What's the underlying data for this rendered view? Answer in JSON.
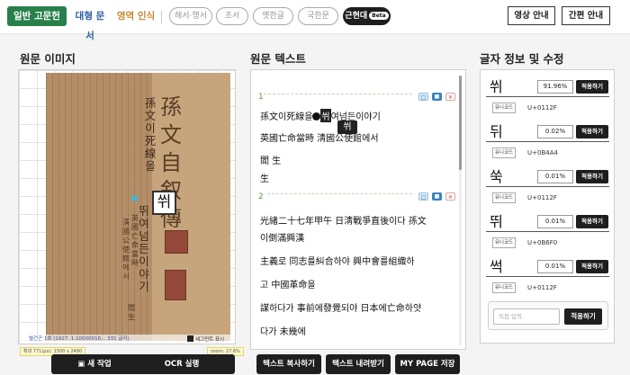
{
  "topbar": {
    "tab_general": "일반 고문헌",
    "tab_large": "대형 문서",
    "tab_area": "영역 인식",
    "pills": [
      "해서·행서",
      "초서",
      "옛한글",
      "국한문"
    ],
    "active_pill": "근현대",
    "active_badge": "Beta",
    "btn_video": "영상 안내",
    "btn_guide": "간편 안내"
  },
  "sections": {
    "image_title": "원문 이미지",
    "text_title": "원문 텍스트",
    "char_title": "글자 정보 및 수정"
  },
  "image_panel": {
    "doc_title": "孫文自叙傳",
    "col_main_1": "孫文이死線을",
    "col_main_2": "뛰여넘든이야기",
    "col_small_1": "英國亡命當時",
    "col_small_2": "淸國公使館에서",
    "col_small_3": "閻生",
    "highlight_char": "쒸",
    "caption": "별건곤 1호 (1927. 1.10000016... 331 글자)",
    "segment_toggle": "세그먼트 표시",
    "zoom_left": "확대 771(px): 1500 x 2480",
    "zoom_right": "zoom: 27.6%"
  },
  "image_buttons": {
    "new_task": "새 작업",
    "ocr_run": "OCR 실행"
  },
  "text_panel": {
    "segments": [
      {
        "num": "1",
        "line1_pre": "孫文이死線을",
        "line1_sel": "쒸",
        "line1_post": "여넘든이야기",
        "popup": "쒸",
        "lines": [
          "英國亡命當時 淸國公使館에서",
          "閻 生",
          "生"
        ]
      },
      {
        "num": "2",
        "lines": [
          "光緖二十七年甲午 日淸戰爭直後이다 孫文",
          "이倒滿興漢",
          "主義로 同志를糾合하야 興中會를組織하",
          "고 中國革命을",
          "謀하다가 事前에發覺되야 日本에亡命하얏",
          "다가 未幾에"
        ]
      }
    ],
    "btn_copy": "텍스트 복사하기",
    "btn_download": "텍스트 내려받기",
    "btn_mypage": "MY PAGE 저장"
  },
  "char_panel": {
    "candidates": [
      {
        "char": "쒸",
        "pct": "91.96%",
        "apply": "적용하기",
        "code_label": "유니코드",
        "code": "U+0112F"
      },
      {
        "char": "뒤",
        "pct": "0.02%",
        "apply": "적용하기",
        "code_label": "유니코드",
        "code": "U+0B4A4"
      },
      {
        "char": "쑥",
        "pct": "0.01%",
        "apply": "적용하기",
        "code_label": "유니코드",
        "code": "U+0112F"
      },
      {
        "char": "뛰",
        "pct": "0.01%",
        "apply": "적용하기",
        "code_label": "유니코드",
        "code": "U+0B6F0"
      },
      {
        "char": "썩",
        "pct": "0.01%",
        "apply": "적용하기",
        "code_label": "유니코드",
        "code": "U+0112F"
      }
    ],
    "direct_placeholder": "직접 입력",
    "direct_apply": "적용하기"
  },
  "colors": {
    "accent_green": "#27804a",
    "accent_blue": "#2c5e9f",
    "accent_orange": "#c5882e",
    "dark": "#1e1e1e"
  }
}
